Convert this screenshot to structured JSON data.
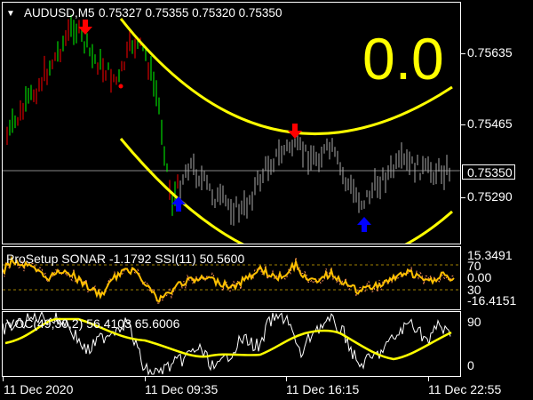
{
  "main": {
    "symbol": "AUDUSD,M5",
    "ohlc": "0.75327 0.75355 0.75320 0.75350",
    "big_value": "0.0",
    "price_labels": [
      "0.75635",
      "0.75465",
      "0.75290"
    ],
    "current_price": "0.75350"
  },
  "sub1": {
    "label": "ProSetup SONAR -1.1792  SSI(11) 50.5600",
    "axis": [
      "15.3491",
      "70",
      "0.00",
      "30",
      "-16.4151"
    ]
  },
  "sub2": {
    "label": "VOC(49,30,2) 56.4103 65.6006",
    "axis": [
      "90",
      "0"
    ]
  },
  "time_labels": [
    "11 Dec 2020",
    "11 Dec 09:35",
    "11 Dec 16:15",
    "11 Dec 22:55"
  ],
  "colors": {
    "up": "#00ff00",
    "down": "#ff0000",
    "signal": "#ffff00",
    "sonar": "#ffc000",
    "buy_arrow": "#0000ff",
    "sell_arrow": "#ff0000"
  }
}
